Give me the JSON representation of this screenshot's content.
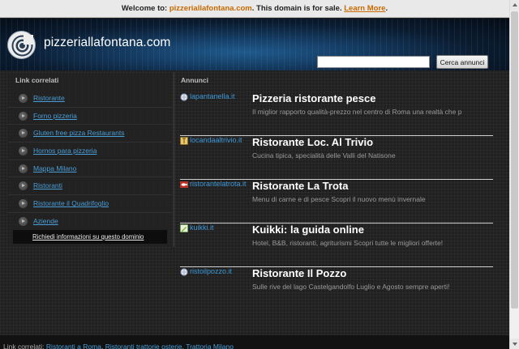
{
  "banner": {
    "prefix": "Welcome to: ",
    "domain": "pizzeriallafontana.com",
    "middle": ". This domain is for sale. ",
    "learn_more": "Learn More",
    "suffix": "."
  },
  "header": {
    "site_title": "pizzeriallafontana.com",
    "search_button": "Cerca annunci",
    "search_value": ""
  },
  "sidebar": {
    "title": "Link correlati",
    "items": [
      {
        "label": "Ristorante"
      },
      {
        "label": "Forno pizzeria"
      },
      {
        "label": "Gluten free pizza Restaurants"
      },
      {
        "label": "Hornos para pizzeria"
      },
      {
        "label": "Mappa Milano"
      },
      {
        "label": "Ristoranti"
      },
      {
        "label": "Ristorante il Quadrifoglio"
      },
      {
        "label": "Aziende"
      }
    ],
    "info_link": "Richiedi informazioni su questo dominio"
  },
  "ads": {
    "title": "Annunci",
    "items": [
      {
        "domain": "lapantanella.it",
        "title": "Pizzeria ristorante pesce",
        "desc": "Il miglior rapporto qualità-prezzo nel centro di Roma una realtà che p",
        "icon": "globe-icon",
        "icon_color": "#cfd8e8"
      },
      {
        "domain": "locandaaltrivio.it",
        "title": "Ristorante Loc. Al Trivio",
        "desc": "Cucina tipica, specialità delle Valli del Natisone",
        "icon": "sign-icon",
        "icon_color": "#d8b85a"
      },
      {
        "domain": "ristorantelatrota.it",
        "title": "Ristorante La Trota",
        "desc": "Menu di carne e di pesce Scopri il nuovo menù invernale",
        "icon": "fish-icon",
        "icon_color": "#b8322a"
      },
      {
        "domain": "kuikki.it",
        "title": "Kuikki: la guida online",
        "desc": "Hotel, B&B, ristoranti, agriturismi Scopri tutte le migliori offerte!",
        "icon": "pencil-icon",
        "icon_color": "#7ab648"
      },
      {
        "domain": "ristoilpozzo.it",
        "title": "Ristorante Il Pozzo",
        "desc": "Sulle rive del lago Castelgandolfo Luglio e Agosto sempre aperti!",
        "icon": "globe-icon",
        "icon_color": "#cfd8e8"
      }
    ]
  },
  "footer": {
    "prefix": "Link correlati: ",
    "links": [
      "Ristoranti a Roma",
      "Ristoranti trattorie osterie",
      "Trattoria Milano"
    ]
  },
  "colors": {
    "link": "#4a9fd8",
    "accent_orange": "#c86a00",
    "header_blue": "#1f5a8c"
  }
}
